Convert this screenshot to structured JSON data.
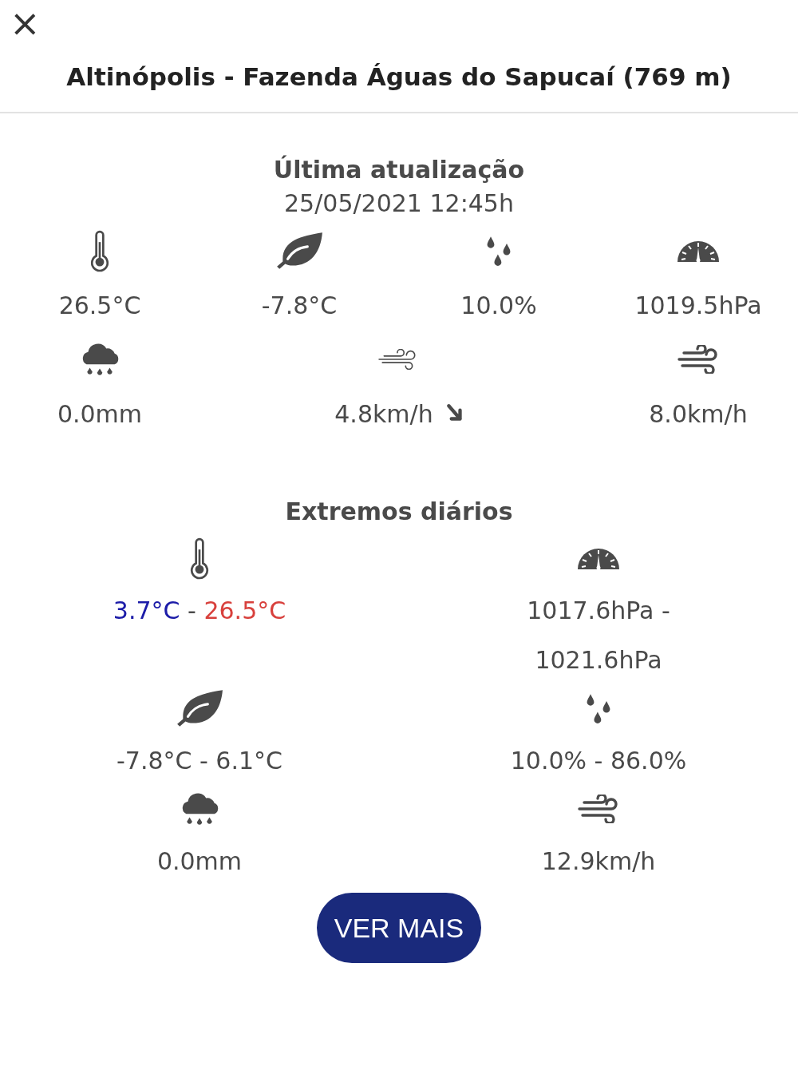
{
  "close_button": {
    "label": "×"
  },
  "title": "Altinópolis - Fazenda Águas do Sapucaí (769 m)",
  "current": {
    "heading": "Última atualização",
    "timestamp": "25/05/2021 12:45h",
    "readings": [
      {
        "kind": "thermometer",
        "value": "26.5°C"
      },
      {
        "kind": "leaf",
        "value": "-7.8°C"
      },
      {
        "kind": "drops",
        "value": "10.0%"
      },
      {
        "kind": "gauge",
        "value": "1019.5hPa"
      },
      {
        "kind": "rain",
        "value": "0.0mm"
      },
      {
        "kind": "breeze",
        "value": "4.8km/h"
      },
      {
        "kind": "wind",
        "value": "8.0km/h"
      }
    ]
  },
  "extremes": {
    "heading": "Extremos diários",
    "items": [
      {
        "kind": "thermometer",
        "parts": [
          {
            "text": "3.7°C",
            "color": "#1c1ca8"
          },
          {
            "text": "-",
            "color": "#4a4a4a"
          },
          {
            "text": "26.5°C",
            "color": "#d8403c"
          }
        ]
      },
      {
        "kind": "gauge",
        "value": "1017.6hPa - 1021.6hPa"
      },
      {
        "kind": "leaf",
        "value": "-7.8°C - 6.1°C"
      },
      {
        "kind": "drops",
        "value": "10.0% - 86.0%"
      },
      {
        "kind": "rain",
        "value": "0.0mm"
      },
      {
        "kind": "wind",
        "value": "12.9km/h"
      }
    ]
  },
  "more_button": {
    "label": "VER MAIS"
  }
}
